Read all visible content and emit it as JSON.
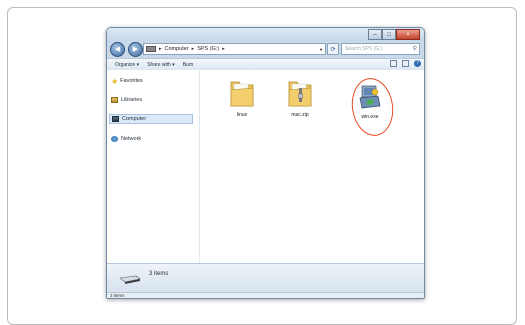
{
  "window": {
    "caption_buttons": {
      "minimize": "–",
      "maximize": "□",
      "close": "×"
    }
  },
  "address_bar": {
    "crumbs": [
      "Computer",
      "SPS (G:)"
    ],
    "separator": "▸",
    "search_placeholder": "Search SPS (G:)"
  },
  "toolbar": {
    "organize": "Organize ▾",
    "share_with": "Share with ▾",
    "burn": "Burn"
  },
  "navigation": {
    "items": [
      {
        "label": "Favorites",
        "icon": "star-icon"
      },
      {
        "label": "Libraries",
        "icon": "library-icon"
      },
      {
        "label": "Computer",
        "icon": "computer-icon",
        "selected": true
      },
      {
        "label": "Network",
        "icon": "network-icon"
      }
    ]
  },
  "files": [
    {
      "name": "linux",
      "icon": "folder-icon"
    },
    {
      "name": "mac.zip",
      "icon": "zip-folder-icon"
    },
    {
      "name": "win.exe",
      "icon": "installer-icon",
      "highlighted": true
    }
  ],
  "details_pane": {
    "item_count": "3 items"
  },
  "status_bar": {
    "text": "3 items"
  },
  "colors": {
    "highlight_circle": "#e74c24",
    "window_frame": "#c9d9ea"
  }
}
